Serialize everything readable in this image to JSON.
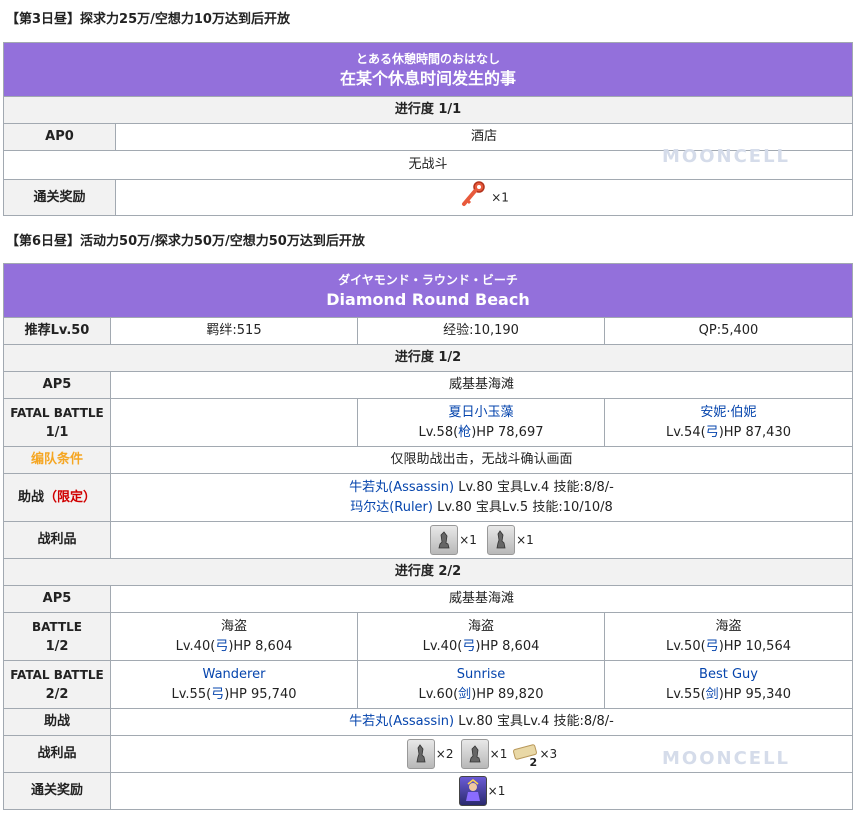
{
  "section1": {
    "title": "【第3日昼】探求力25万/空想力10万达到后开放",
    "jp_title": "とある休憩時間のおはなし",
    "cn_title": "在某个休息时间发生的事",
    "progress": "进行度 1/1",
    "ap_label": "AP0",
    "location": "酒店",
    "no_battle": "无战斗",
    "reward_label": "通关奖励",
    "reward_qty": "×1",
    "reward_icon": "red-key-icon"
  },
  "section2": {
    "title": "【第6日昼】活动力50万/探求力50万/空想力50万达到后开放",
    "jp_title": "ダイヤモンド・ラウンド・ビーチ",
    "cn_title": "Diamond Round Beach",
    "rec_level": "推荐Lv.50",
    "bond": "羁绊:515",
    "exp": "经验:10,190",
    "qp": "QP:5,400",
    "p1": {
      "progress": "进行度 1/2",
      "ap_label": "AP5",
      "location": "威基基海滩",
      "battle_label_1": "FATAL BATTLE",
      "battle_label_2": "1/1",
      "enemy1_name": "夏日小玉藻",
      "enemy1_pre": "Lv.58(",
      "enemy1_class": "枪",
      "enemy1_post": ")HP 78,697",
      "enemy2_name": "安妮·伯妮",
      "enemy2_pre": "Lv.54(",
      "enemy2_class": "弓",
      "enemy2_post": ")HP 87,430",
      "formation_label": "编队条件",
      "formation_text": "仅限助战出击，无战斗确认画面",
      "support_label": "助战",
      "support_limited": "（限定）",
      "support1_name": "牛若丸(Assassin)",
      "support1_info": " Lv.80 宝具Lv.4 技能:8/8/-",
      "support2_name": "玛尔达(Ruler)",
      "support2_info": " Lv.80 宝具Lv.5 技能:10/10/8",
      "loot_label": "战利品",
      "loot1_qty": "×1",
      "loot2_qty": "×1"
    },
    "p2": {
      "progress": "进行度 2/2",
      "ap_label": "AP5",
      "location": "威基基海滩",
      "battle1_label_1": "BATTLE",
      "battle1_label_2": "1/2",
      "b1_e1_name": "海盗",
      "b1_e1_pre": "Lv.40(",
      "b1_e1_class": "弓",
      "b1_e1_post": ")HP 8,604",
      "b1_e2_name": "海盗",
      "b1_e2_pre": "Lv.40(",
      "b1_e2_class": "弓",
      "b1_e2_post": ")HP 8,604",
      "b1_e3_name": "海盗",
      "b1_e3_pre": "Lv.50(",
      "b1_e3_class": "弓",
      "b1_e3_post": ")HP 10,564",
      "battle2_label_1": "FATAL BATTLE",
      "battle2_label_2": "2/2",
      "b2_e1_name": "Wanderer",
      "b2_e1_pre": "Lv.55(",
      "b2_e1_class": "弓",
      "b2_e1_post": ")HP 95,740",
      "b2_e2_name": "Sunrise",
      "b2_e2_pre": "Lv.60(",
      "b2_e2_class": "剑",
      "b2_e2_post": ")HP 89,820",
      "b2_e3_name": "Best Guy",
      "b2_e3_pre": "Lv.55(",
      "b2_e3_class": "剑",
      "b2_e3_post": ")HP 95,340",
      "support_label": "助战",
      "support1_name": "牛若丸(Assassin)",
      "support1_info": " Lv.80 宝具Lv.4 技能:8/8/-",
      "loot_label": "战利品",
      "loot1_qty": "×2",
      "loot2_qty": "×1",
      "loot3_badge": "2",
      "loot3_qty": "×3",
      "reward_label": "通关奖励",
      "reward_qty": "×1"
    }
  },
  "watermark": "MOONCELL",
  "colors": {
    "header_bg": "#9370db",
    "link": "#0645ad",
    "formation": "#f5a623",
    "limited": "#d00000"
  }
}
